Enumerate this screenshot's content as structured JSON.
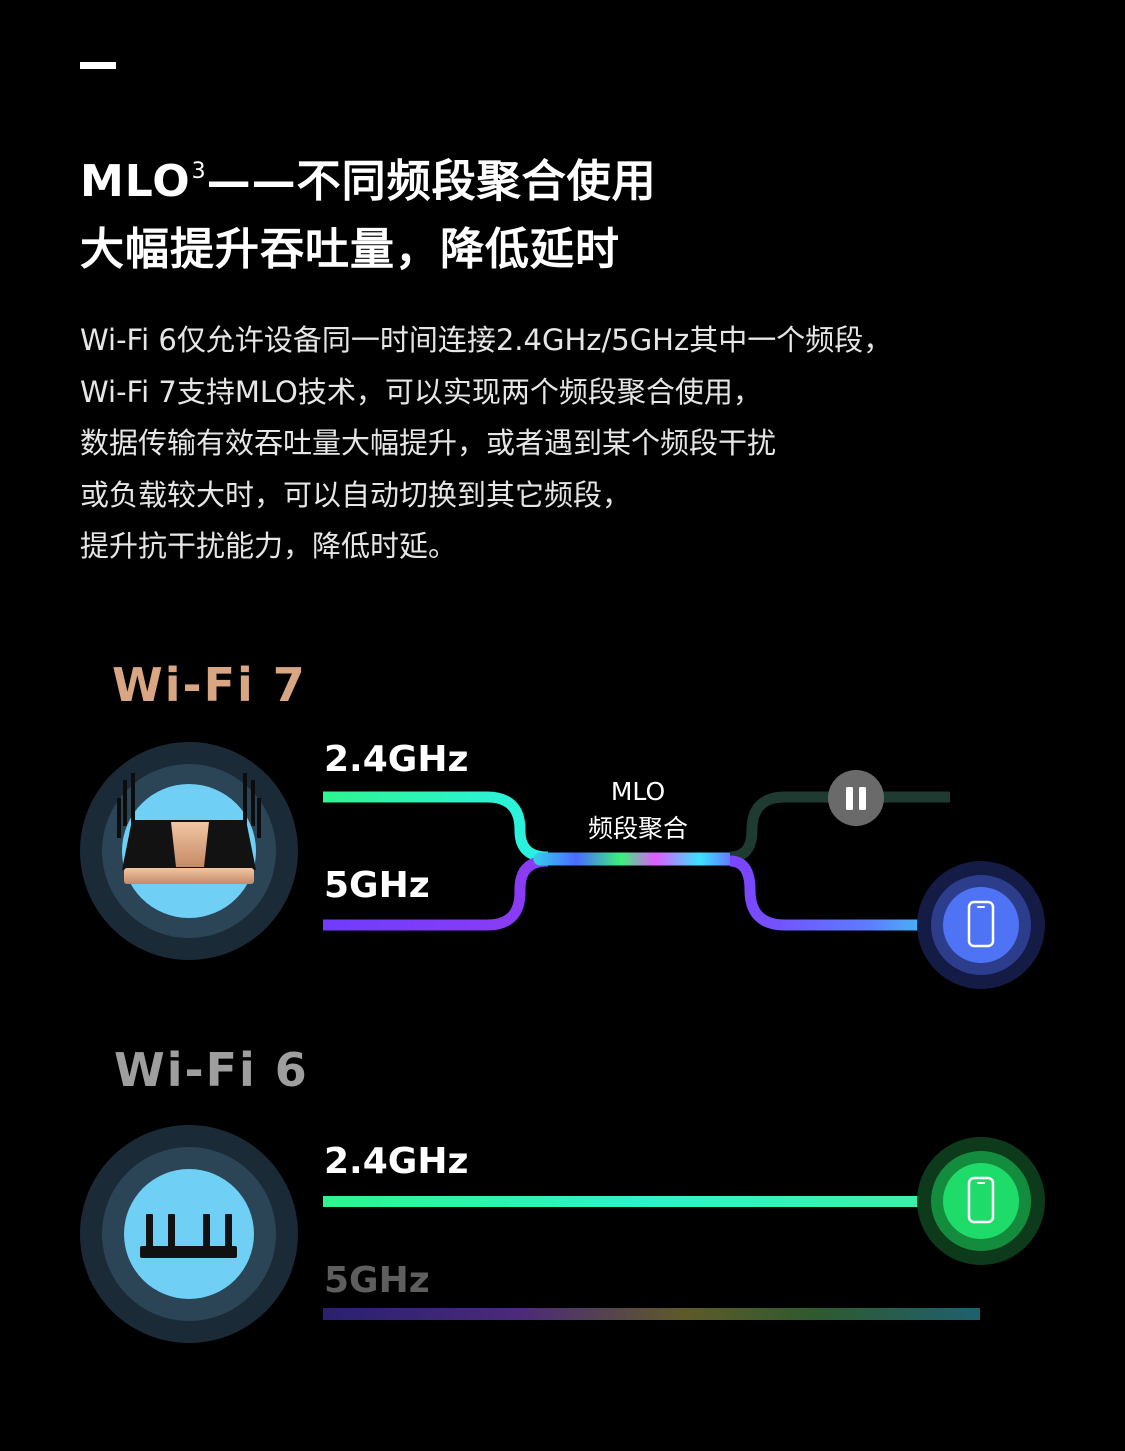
{
  "header": {
    "title_line1_pre": "MLO",
    "title_line1_sup": "3",
    "title_line1_post": "——不同频段聚合使用",
    "title_line2": "大幅提升吞吐量，降低延时"
  },
  "description": [
    "Wi-Fi 6仅允许设备同一时间连接2.4GHz/5GHz其中一个频段，",
    "Wi-Fi 7支持MLO技术，可以实现两个频段聚合使用，",
    "数据传输有效吞吐量大幅提升，或者遇到某个频段干扰",
    "或负载较大时，可以自动切换到其它频段，",
    "提升抗干扰能力，降低时延。"
  ],
  "wifi7": {
    "logo": "Wi-Fi 7",
    "band_24": "2.4GHz",
    "band_5": "5GHz",
    "mlo_line1": "MLO",
    "mlo_line2": "频段聚合"
  },
  "wifi6": {
    "logo": "Wi-Fi 6",
    "band_24": "2.4GHz",
    "band_5": "5GHz"
  },
  "icons": [
    "router-icon",
    "pause-icon",
    "phone-icon"
  ],
  "colors": {
    "background": "#000000",
    "wifi7_logo": "#d9a683",
    "wifi6_logo": "#9e9e9e",
    "band_24": "#2ef58f",
    "band_5": "#6f3cff",
    "phone_blue": "#4f73f5",
    "phone_green": "#1fdc6a"
  }
}
